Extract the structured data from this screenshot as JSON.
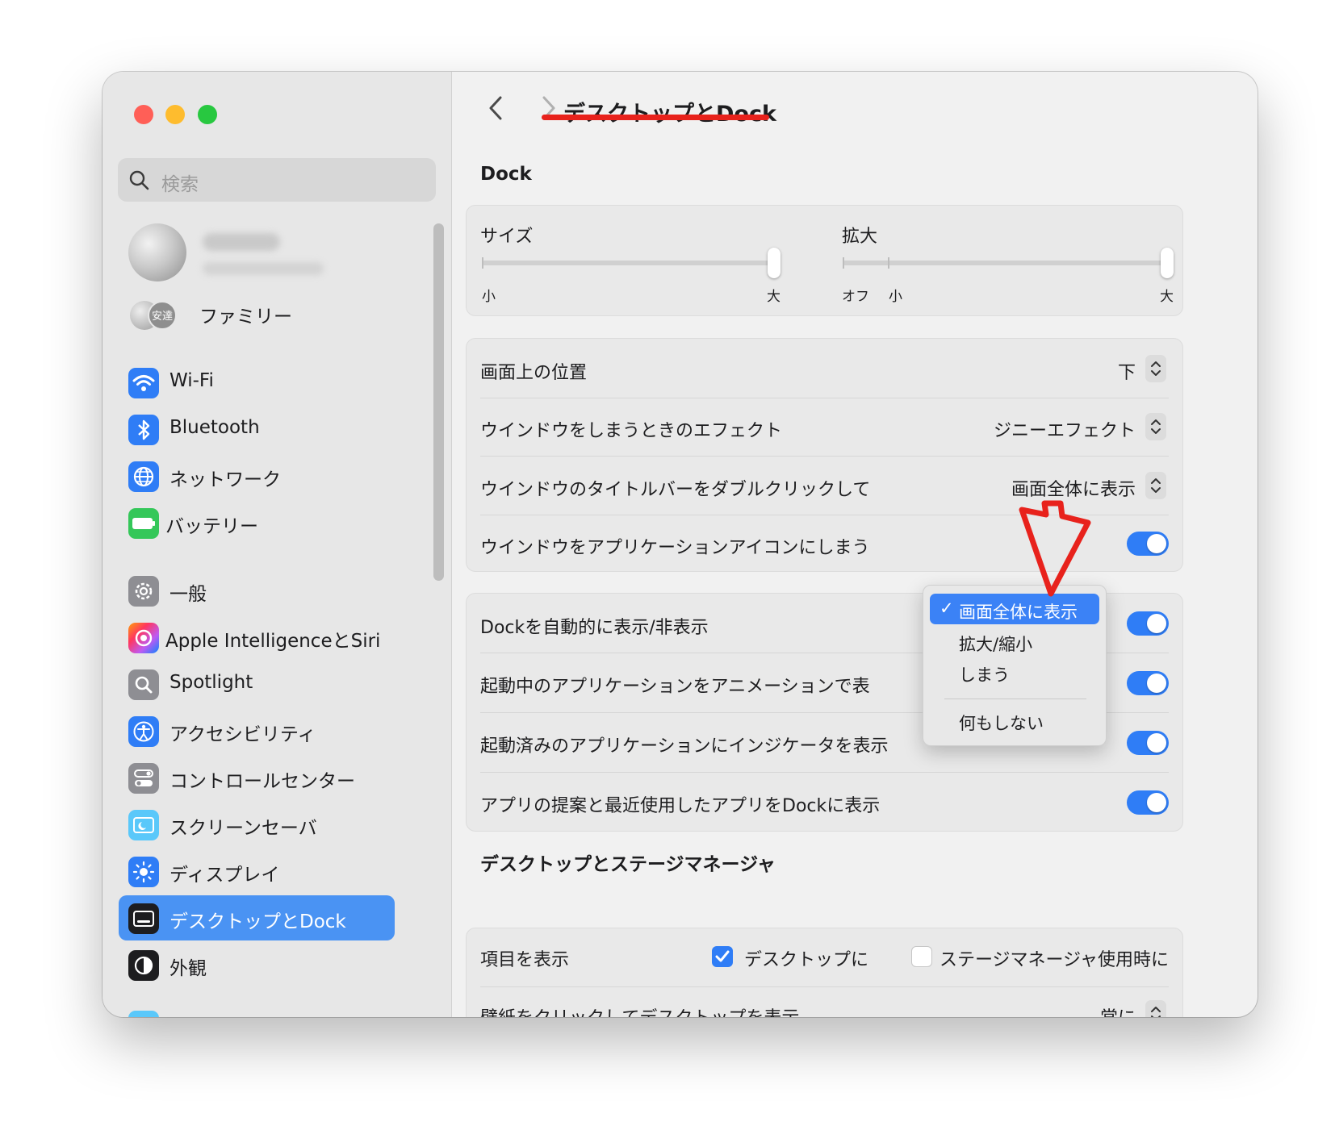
{
  "window": {
    "traffic_colors": [
      "#ff5f57",
      "#febc2e",
      "#28c840"
    ]
  },
  "sidebar": {
    "search_placeholder": "検索",
    "family_label": "ファミリー",
    "family_badge": "安達",
    "items": [
      {
        "label": "Wi-Fi",
        "icon": "wifi-icon",
        "color": "#2f7df6"
      },
      {
        "label": "Bluetooth",
        "icon": "bluetooth-icon",
        "color": "#2f7df6"
      },
      {
        "label": "ネットワーク",
        "icon": "globe-icon",
        "color": "#2f7df6"
      },
      {
        "label": "バッテリー",
        "icon": "battery-icon",
        "color": "#34c759"
      },
      {
        "label": "一般",
        "icon": "gear-icon",
        "color": "#8e8e93"
      },
      {
        "label": "Apple IntelligenceとSiri",
        "icon": "siri-icon",
        "color": "#ff5ea8"
      },
      {
        "label": "Spotlight",
        "icon": "magnifier-icon",
        "color": "#8e8e93"
      },
      {
        "label": "アクセシビリティ",
        "icon": "accessibility-icon",
        "color": "#2f7df6"
      },
      {
        "label": "コントロールセンター",
        "icon": "control-center-icon",
        "color": "#8e8e93"
      },
      {
        "label": "スクリーンセーバ",
        "icon": "screensaver-icon",
        "color": "#5ac8fa"
      },
      {
        "label": "ディスプレイ",
        "icon": "sun-icon",
        "color": "#2f7df6"
      },
      {
        "label": "デスクトップとDock",
        "icon": "dock-icon",
        "color": "#1d1d1f",
        "active": true
      },
      {
        "label": "外観",
        "icon": "appearance-icon",
        "color": "#1d1d1f"
      }
    ]
  },
  "header": {
    "title": "デスクトップとDock"
  },
  "dock": {
    "section_title": "Dock",
    "size": {
      "label": "サイズ",
      "min_label": "小",
      "max_label": "大",
      "value": 1.0
    },
    "magnify": {
      "label": "拡大",
      "off_label": "オフ",
      "min_label": "小",
      "max_label": "大",
      "value": 1.0
    },
    "settings": [
      {
        "label": "画面上の位置",
        "value": "下"
      },
      {
        "label": "ウインドウをしまうときのエフェクト",
        "value": "ジニーエフェクト"
      },
      {
        "label": "ウインドウのタイトルバーをダブルクリックして",
        "value": "画面全体に表示"
      },
      {
        "label": "ウインドウをアプリケーションアイコンにしまう",
        "toggle": true
      }
    ],
    "toggles": [
      {
        "label": "Dockを自動的に表示/非表示",
        "on": true
      },
      {
        "label": "起動中のアプリケーションをアニメーションで表",
        "on": true
      },
      {
        "label": "起動済みのアプリケーションにインジケータを表示",
        "on": true
      },
      {
        "label": "アプリの提案と最近使用したアプリをDockに表示",
        "on": true
      }
    ]
  },
  "popup_menu": {
    "items": [
      "画面全体に表示",
      "拡大/縮小",
      "しまう",
      "何もしない"
    ],
    "selected": "画面全体に表示",
    "check": "✓"
  },
  "desktop": {
    "section_title": "デスクトップとステージマネージャ",
    "show_items_label": "項目を表示",
    "opt_desktop": "デスクトップに",
    "opt_stage": "ステージマネージャ使用時に",
    "wallpaper_label": "壁紙をクリックしてデスクトップを表示",
    "wallpaper_value": "常に"
  },
  "annotation": {
    "color": "#e8221c"
  }
}
